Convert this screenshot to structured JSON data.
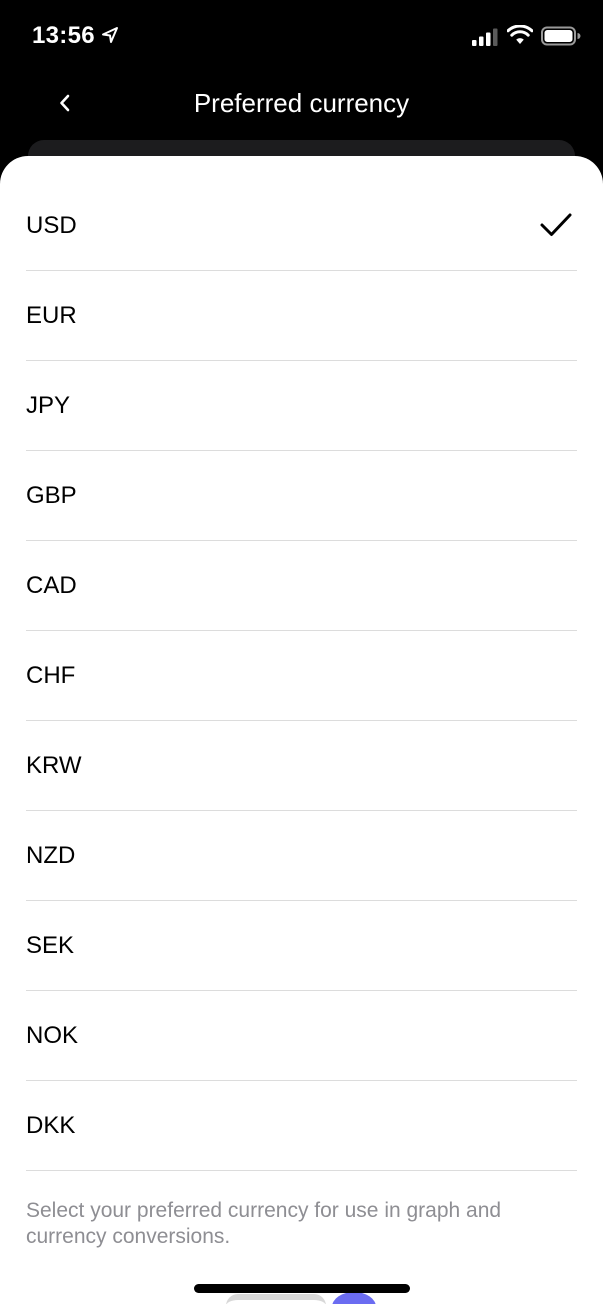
{
  "status_bar": {
    "time": "13:56"
  },
  "nav": {
    "title": "Preferred currency"
  },
  "currencies": [
    {
      "code": "USD",
      "selected": true
    },
    {
      "code": "EUR",
      "selected": false
    },
    {
      "code": "JPY",
      "selected": false
    },
    {
      "code": "GBP",
      "selected": false
    },
    {
      "code": "CAD",
      "selected": false
    },
    {
      "code": "CHF",
      "selected": false
    },
    {
      "code": "KRW",
      "selected": false
    },
    {
      "code": "NZD",
      "selected": false
    },
    {
      "code": "SEK",
      "selected": false
    },
    {
      "code": "NOK",
      "selected": false
    },
    {
      "code": "DKK",
      "selected": false
    }
  ],
  "footer": {
    "text": "Select your preferred currency for use in graph and currency conversions."
  },
  "icons": {
    "back": "chevron-left-icon",
    "check": "checkmark-icon",
    "location": "location-arrow-icon",
    "signal": "cellular-signal-icon",
    "wifi": "wifi-icon",
    "battery": "battery-icon"
  },
  "colors": {
    "background": "#000000",
    "sheet": "#ffffff",
    "separator": "#dcdcdc",
    "footer_text": "#8e8e93",
    "accent_peek": "#5b5cf0"
  }
}
